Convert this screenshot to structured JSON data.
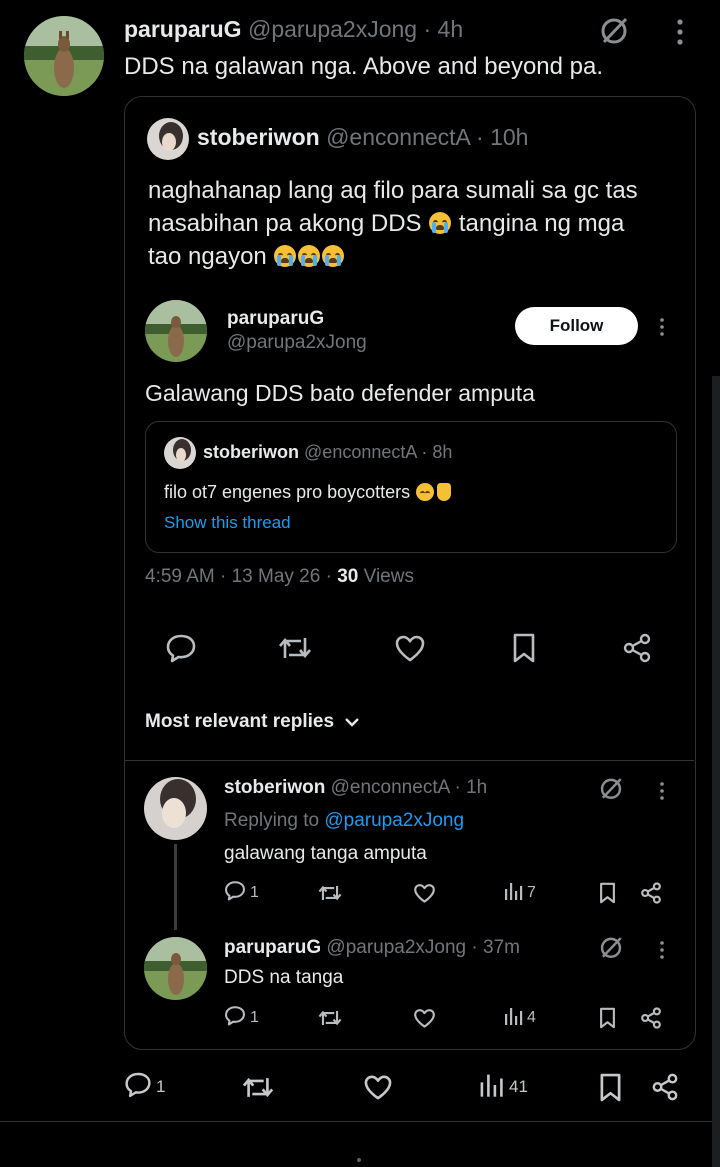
{
  "main_post": {
    "display_name": "paruparuG",
    "handle": "@parupa2xJong",
    "time": "· 4h",
    "text": "DDS na galawan nga. Above and beyond pa."
  },
  "quoted_post": {
    "display_name": "stoberiwon",
    "handle": "@enconnectA",
    "time": "· 10h",
    "text_line1": "naghahanap lang aq filo para sumali sa gc tas",
    "text_line2a": "nasabihan pa akong DDS",
    "text_line2b": "tangina ng mga",
    "text_line3": "tao ngayon"
  },
  "embedded_post": {
    "display_name": "paruparuG",
    "handle": "@parupa2xJong",
    "follow_label": "Follow",
    "text": "Galawang DDS bato defender amputa",
    "inner_quote": {
      "display_name": "stoberiwon",
      "handle": "@enconnectA",
      "time": "· 8h",
      "text": "filo ot7 engenes pro boycotters",
      "show_thread": "Show this thread"
    },
    "meta_time": "4:59 AM · 13 May 26 ·",
    "meta_views_count": "30",
    "meta_views_label": "Views",
    "replies_header": "Most relevant replies"
  },
  "replies": [
    {
      "display_name": "stoberiwon",
      "handle": "@enconnectA",
      "time": "· 1h",
      "replying_prefix": "Replying to",
      "replying_to": "@parupa2xJong",
      "text": "galawang tanga amputa",
      "reply_count": "1",
      "view_count": "7"
    },
    {
      "display_name": "paruparuG",
      "handle": "@parupa2xJong",
      "time": "· 37m",
      "text": "DDS na tanga",
      "reply_count": "1",
      "view_count": "4"
    }
  ],
  "main_actions": {
    "reply_count": "1",
    "view_count": "41"
  },
  "colors": {
    "background": "#000000",
    "text": "#e7e9ea",
    "muted": "#71767b",
    "link": "#1d9bf0",
    "border": "#2f3336"
  }
}
